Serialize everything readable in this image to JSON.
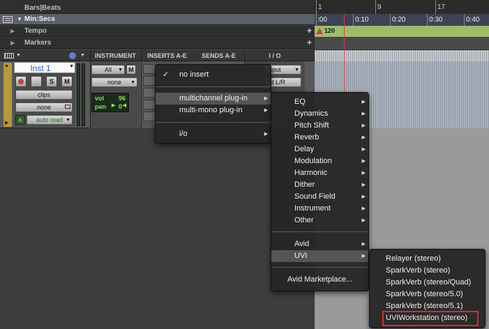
{
  "ruler": {
    "bars_beats": "Bars|Beats",
    "min_secs": "Min:Secs",
    "tempo": "Tempo",
    "markers": "Markers",
    "tempo_value": "120",
    "bars": [
      "1",
      "9",
      "17"
    ],
    "secs": [
      ":00",
      "0:10",
      "0:20",
      "0:30",
      "0:40"
    ]
  },
  "columns": {
    "instrument": "INSTRUMENT",
    "inserts": "INSERTS A-E",
    "sends": "SENDS A-E",
    "io": "I / O"
  },
  "track": {
    "name": "Inst 1",
    "solo": "S",
    "mute": "M",
    "playlist": "clips",
    "timebase": "none",
    "automation": "auto read",
    "midi_channel": "All",
    "midi_m": "M",
    "midi_none": "none",
    "vol_label": "vol",
    "vol_value": "96",
    "pan_label": "pan",
    "pan_value": "0",
    "input_partial": "nput",
    "output_partial": "ut L/R"
  },
  "insert_menu": {
    "check": "✓",
    "no_insert": "no insert",
    "multichannel": "multichannel plug-in",
    "multimono": "multi-mono plug-in",
    "io": "i/o"
  },
  "category_menu": {
    "items": [
      "EQ",
      "Dynamics",
      "Pitch Shift",
      "Reverb",
      "Delay",
      "Modulation",
      "Harmonic",
      "Dither",
      "Sound Field",
      "Instrument",
      "Other"
    ],
    "avid": "Avid",
    "uvi": "UVI",
    "marketplace": "Avid Marketplace..."
  },
  "uvi_menu": {
    "items": [
      "Relayer (stereo)",
      "SparkVerb (stereo)",
      "SparkVerb (stereo/Quad)",
      "SparkVerb (stereo/5.0)",
      "SparkVerb (stereo/5.1)"
    ],
    "highlighted": "UVIWorkstation (stereo)"
  },
  "colors": {
    "timeline_green": "#9cbd6c",
    "playhead": "#d83a3a",
    "highlight_box": "#e0282a",
    "track_name": "#2b5fc9"
  }
}
